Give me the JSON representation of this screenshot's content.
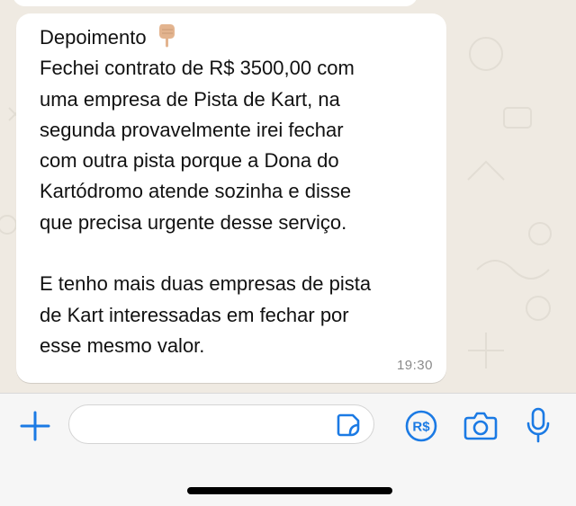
{
  "message": {
    "title": "Depoimento",
    "title_emoji": "backhand-index-pointing-down",
    "body": "Fechei contrato de R$ 3500,00 com\numa empresa de Pista de Kart, na\nsegunda provavelmente irei fechar\ncom outra pista porque a Dona do\nKartódromo atende sozinha e disse\nque precisa urgente desse serviço.\n\nE tenho mais duas empresas de pista\nde Kart interessadas em fechar por\nesse mesmo valor.",
    "time": "19:30"
  },
  "composer": {
    "input_value": "",
    "plus_icon": "plus-icon",
    "sticker_icon": "sticker-icon",
    "payment_icon": "payment-reais-icon",
    "payment_label": "R$",
    "camera_icon": "camera-icon",
    "mic_icon": "microphone-icon"
  },
  "colors": {
    "background": "#efeae2",
    "bubble": "#ffffff",
    "accent": "#1b7ae4",
    "timestamp": "#8a8a8a"
  }
}
